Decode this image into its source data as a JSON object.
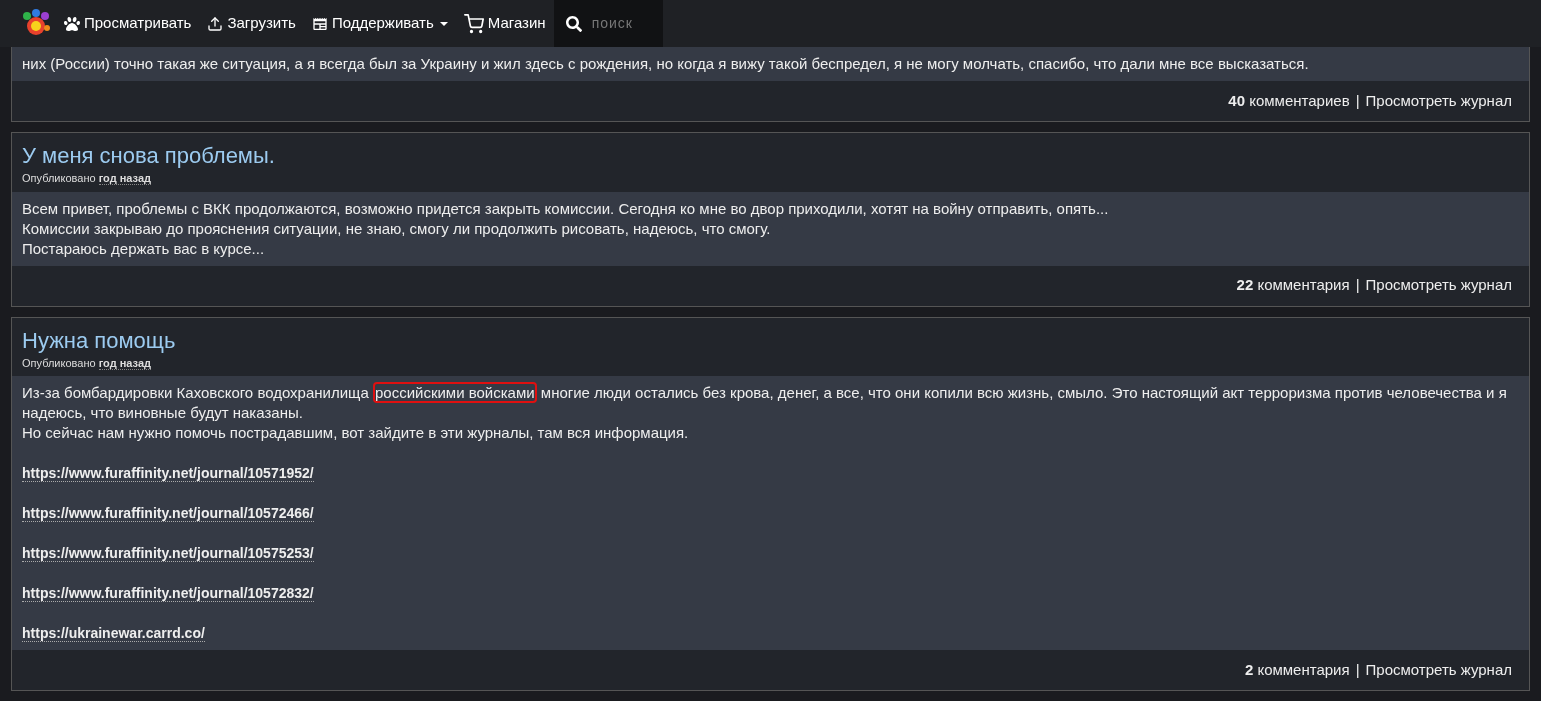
{
  "nav": {
    "items": [
      {
        "kind": "paw",
        "label": "Просматривать"
      },
      {
        "kind": "upload",
        "label": "Загрузить"
      },
      {
        "kind": "support",
        "label": "Поддерживать",
        "dropdown": true
      },
      {
        "kind": "cart",
        "label": "Магазин"
      }
    ],
    "search": {
      "placeholder": "поиск"
    }
  },
  "journals": [
    {
      "partial": true,
      "paragraphs": [
        {
          "kind": "text",
          "text": "них (России) точно такая же ситуация, а я всегда был за Украину и жил здесь с рождения, но когда я вижу такой беспредел, я не могу молчать, спасибо, что дали мне все высказаться."
        }
      ],
      "comments_count": "40",
      "comments_label": "комментариев",
      "separator": "|",
      "view_link": "Просмотреть журнал"
    },
    {
      "partial": false,
      "title": "У меня снова проблемы.",
      "posted_label": "Опубликовано",
      "posted_time": "год назад",
      "paragraphs": [
        {
          "kind": "text",
          "text": "Всем привет, проблемы с ВКК продолжаются, возможно придется закрыть комиссии. Сегодня ко мне во двор приходили, хотят на войну отправить, опять..."
        },
        {
          "kind": "text",
          "text": "Комиссии закрываю до прояснения ситуации, не знаю, смогу ли продолжить рисовать, надеюсь, что смогу."
        },
        {
          "kind": "text",
          "text": "Постараюсь держать вас в курсе..."
        }
      ],
      "comments_count": "22",
      "comments_label": "комментария",
      "separator": "|",
      "view_link": "Просмотреть журнал"
    },
    {
      "partial": false,
      "title": "Нужна помощь",
      "posted_label": "Опубликовано",
      "posted_time": "год назад",
      "paragraphs": [
        {
          "kind": "annotated",
          "before": "Из-за бомбардировки Каховского водохранилища ",
          "marked": "российскими войсками",
          "after": " многие люди остались без крова, денег, а все, что они копили всю жизнь, смыло. Это настоящий акт терроризма против человечества и я надеюсь, что виновные будут наказаны."
        },
        {
          "kind": "text",
          "text": "Но сейчас нам нужно помочь пострадавшим, вот зайдите в эти журналы, там вся информация."
        },
        {
          "kind": "link",
          "text": "https://www.furaffinity.net/journal/10571952/"
        },
        {
          "kind": "link",
          "text": "https://www.furaffinity.net/journal/10572466/"
        },
        {
          "kind": "link",
          "text": "https://www.furaffinity.net/journal/10575253/"
        },
        {
          "kind": "link",
          "text": "https://www.furaffinity.net/journal/10572832/"
        },
        {
          "kind": "link",
          "text": "https://ukrainewar.carrd.co/"
        }
      ],
      "comments_count": "2",
      "comments_label": "комментария",
      "separator": "|",
      "view_link": "Просмотреть журнал"
    }
  ]
}
